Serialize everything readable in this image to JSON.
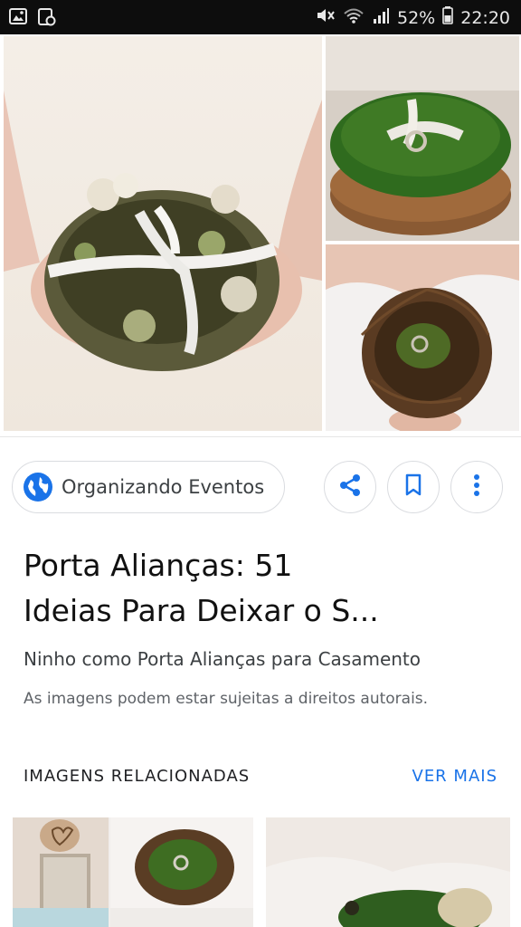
{
  "status_bar": {
    "battery": "52%",
    "time": "22:20",
    "icons": [
      "gallery-icon",
      "screenshot-icon",
      "mute-icon",
      "wifi-icon",
      "signal-icon",
      "battery-icon"
    ]
  },
  "hero": {
    "images": [
      "ring-nest-flowers-hands",
      "moss-nest-rings-bowl",
      "twig-nest-rings-hands"
    ]
  },
  "source": {
    "name": "Organizando Eventos",
    "icon": "globe-icon"
  },
  "actions": {
    "share_icon": "share-icon",
    "bookmark_icon": "bookmark-icon",
    "more_icon": "more-vert-icon"
  },
  "result": {
    "title_line1": "Porta Alianças: 51",
    "title_line2": "Ideias Para Deixar o S...",
    "subtitle": "Ninho como Porta Alianças para Casamento",
    "copyright": "As imagens podem estar sujeitas a direitos autorais."
  },
  "related": {
    "header": "IMAGENS RELACIONADAS",
    "see_more": "VER MAIS"
  },
  "colors": {
    "accent": "#1a73e8",
    "status_bar": "#0d0d0d",
    "moss": "#3f7a25"
  }
}
